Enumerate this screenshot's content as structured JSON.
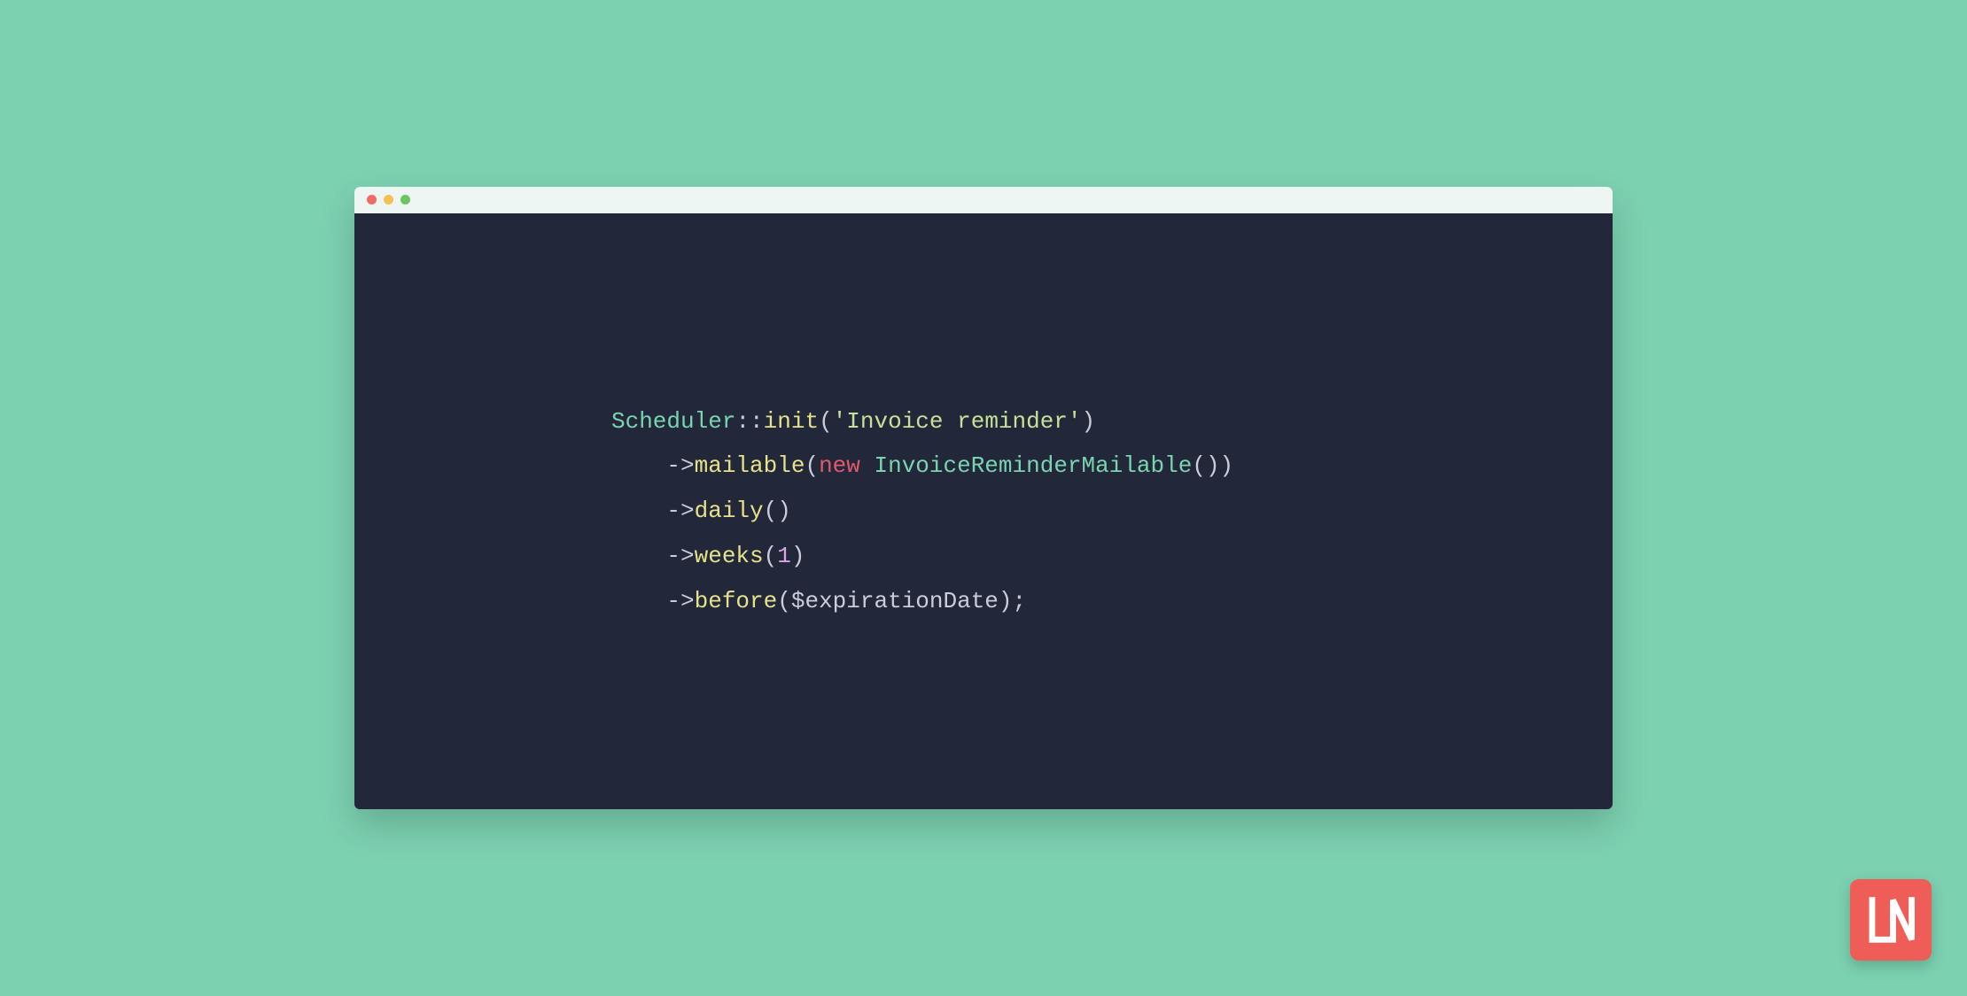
{
  "window": {
    "traffic_light_colors": {
      "close": "#ef6b64",
      "min": "#f5c04f",
      "max": "#6bc662"
    }
  },
  "code": {
    "class_name": "Scheduler",
    "scope_op": "::",
    "init_method": "init",
    "init_arg_string": "'Invoice reminder'",
    "arrow": "->",
    "mailable_method": "mailable",
    "new_kw": "new",
    "mailable_class": "InvoiceReminderMailable",
    "daily_method": "daily",
    "weeks_method": "weeks",
    "weeks_arg": "1",
    "before_method": "before",
    "before_arg_var": "$expirationDate",
    "open_paren": "(",
    "close_paren": ")",
    "dbl_close_paren": "())",
    "close_paren_semi": ");"
  },
  "badge": {
    "label": "LN"
  }
}
